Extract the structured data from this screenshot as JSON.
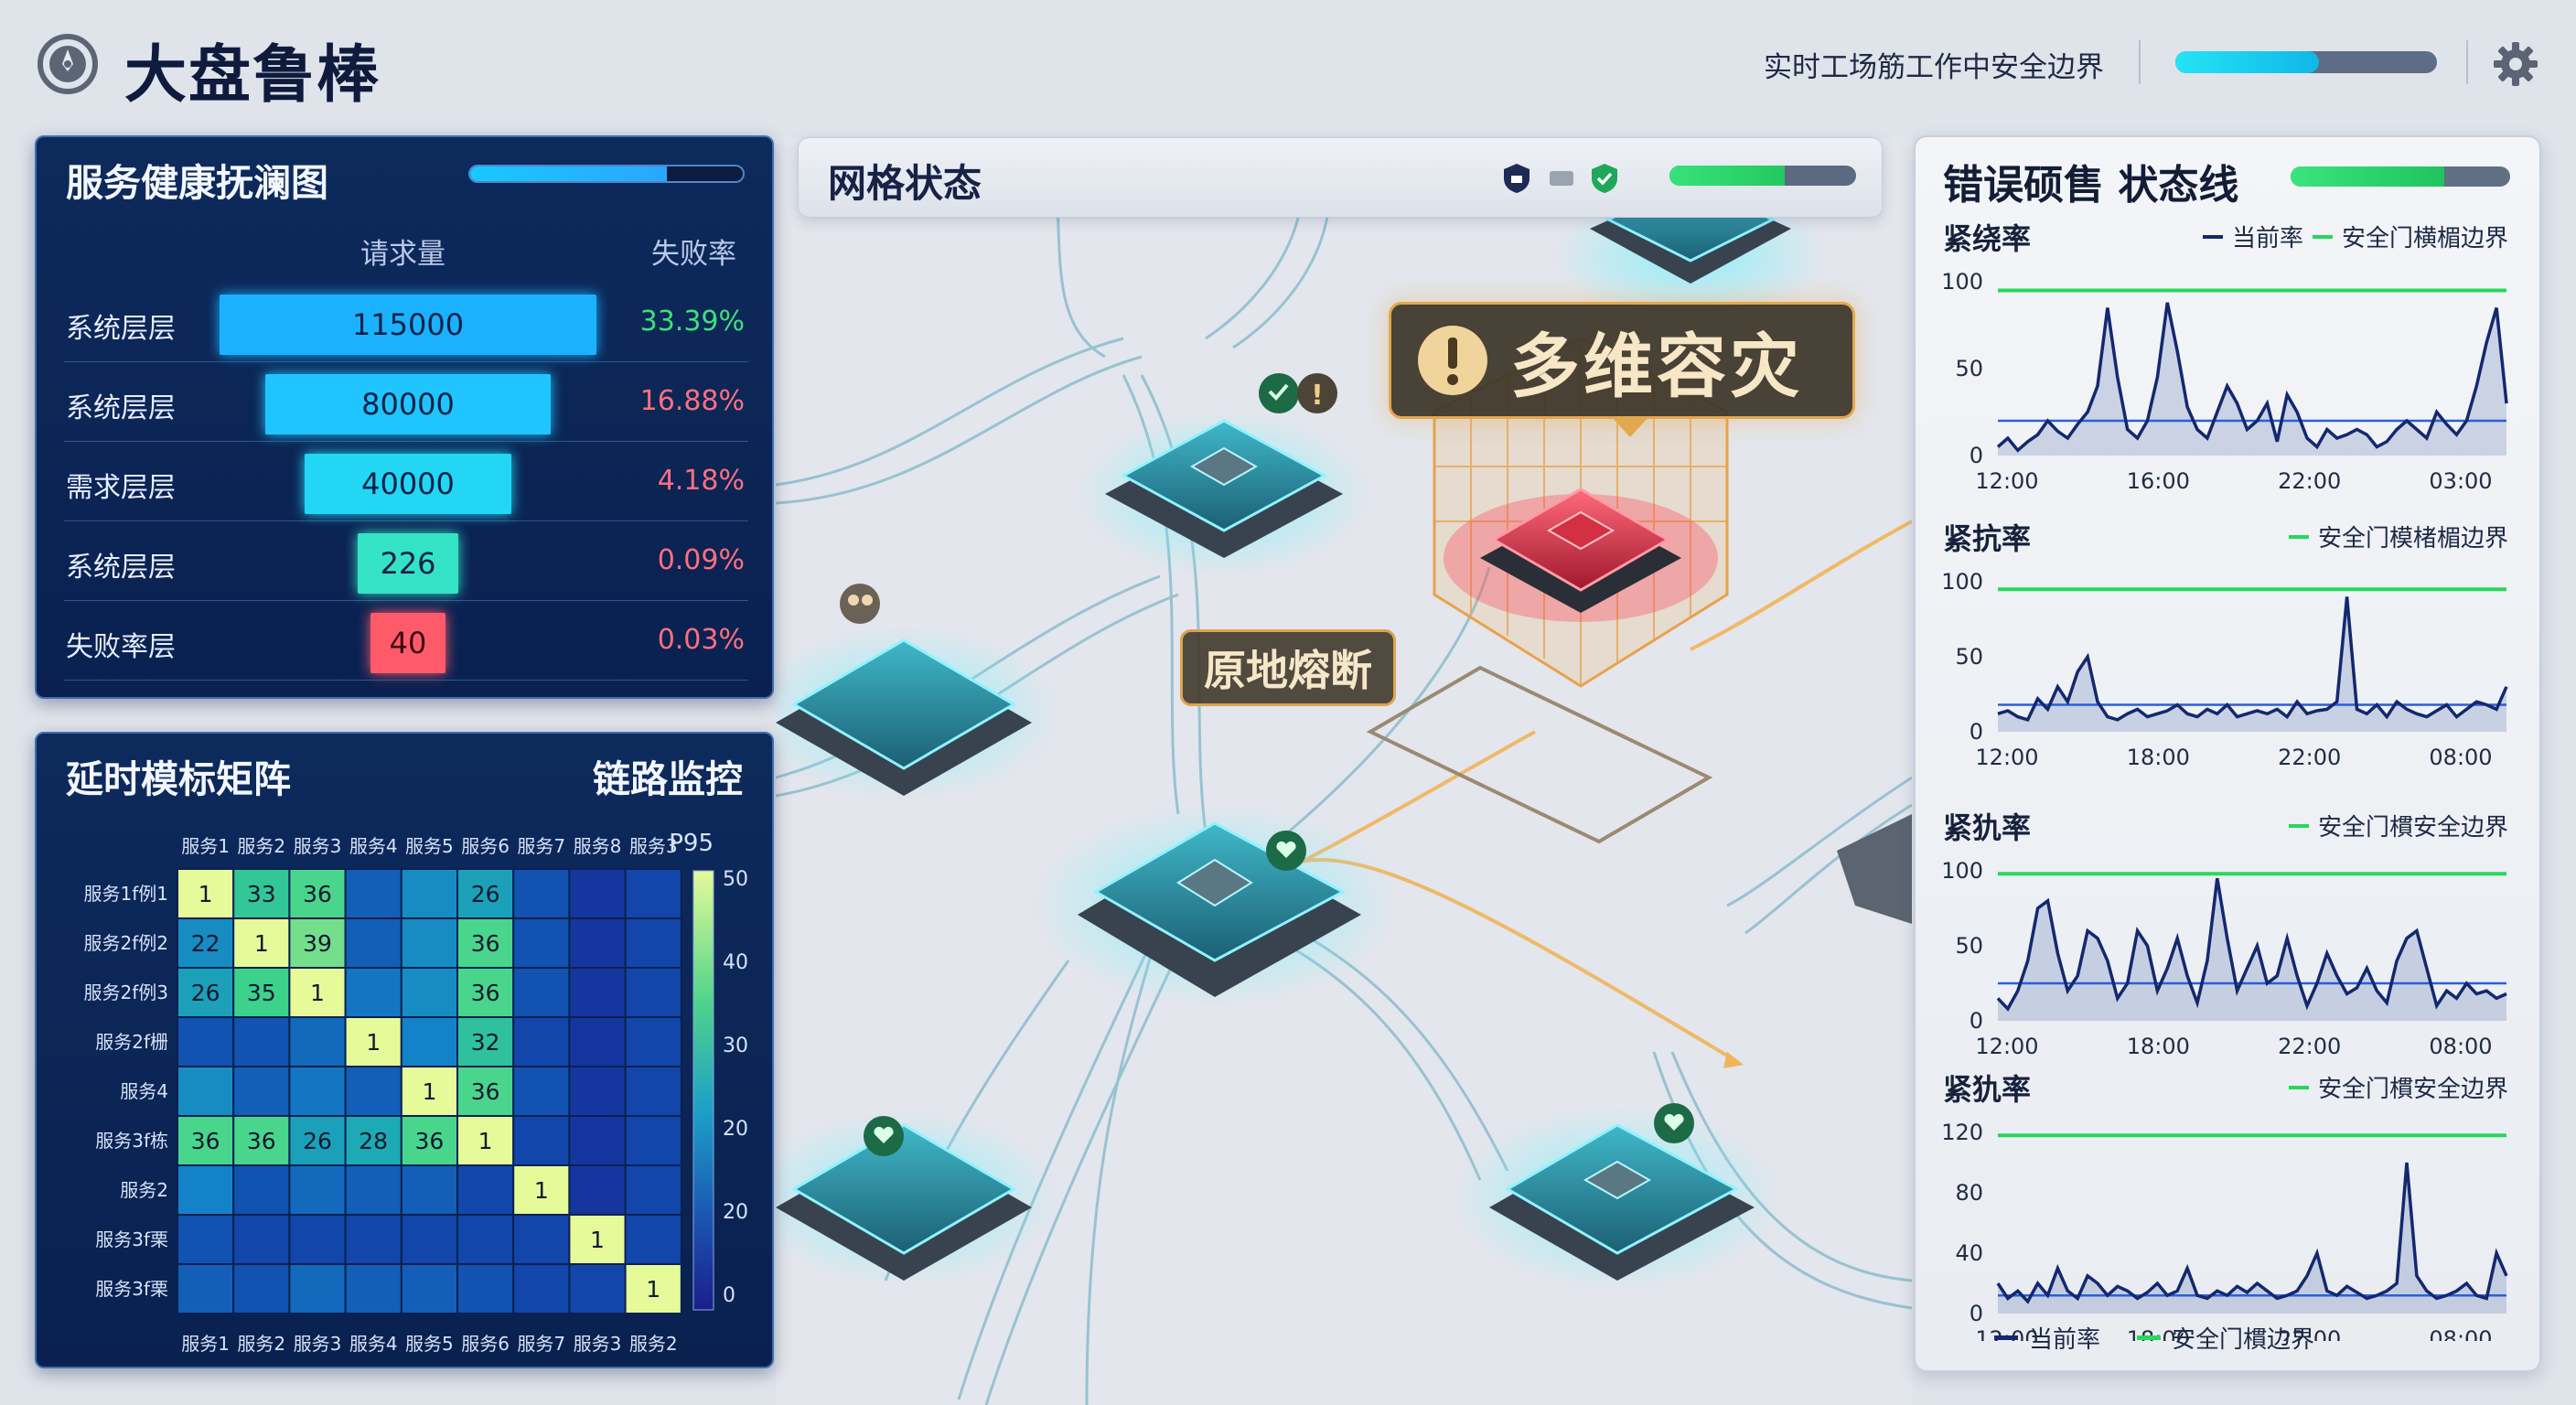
{
  "app": {
    "title": "大盘鲁棒"
  },
  "header": {
    "status_text": "实时工场筋工作中安全边界",
    "progress": 0.55
  },
  "funnel": {
    "title": "服务健康抚澜图",
    "progress": 0.72,
    "col_requests": "请求量",
    "col_fail": "失败率",
    "rows": [
      {
        "label": "系统层层",
        "value": "115000",
        "rate": "33.39%",
        "rate_color": "#3ee07a",
        "bar_color": "#1ab2ff"
      },
      {
        "label": "系统层层",
        "value": "80000",
        "rate": "16.88%",
        "rate_color": "#ff6f7e",
        "bar_color": "#20c4ff"
      },
      {
        "label": "需求层层",
        "value": "40000",
        "rate": "4.18%",
        "rate_color": "#ff6f7e",
        "bar_color": "#22d6f4"
      },
      {
        "label": "系统层层",
        "value": "226",
        "rate": "0.09%",
        "rate_color": "#ff6f7e",
        "bar_color": "#34e3c6"
      },
      {
        "label": "失败率层",
        "value": "40",
        "rate": "0.03%",
        "rate_color": "#ff6f7e",
        "bar_color": "#ff5a6a"
      }
    ]
  },
  "matrix": {
    "title": "延时模标矩阵",
    "subtitle": "链路监控",
    "metric": "P95",
    "col_labels": [
      "服务1",
      "服务2",
      "服务3",
      "服务4",
      "服务5",
      "服务6",
      "服务7",
      "服务8",
      "服务3"
    ],
    "bottom_labels": [
      "服务1",
      "服务2",
      "服务3",
      "服务4",
      "服务5",
      "服务6",
      "服务7",
      "服务3",
      "服务2"
    ],
    "row_labels": [
      "服务1f例1",
      "服务2f例2",
      "服务2f例3",
      "服务2f栅",
      "服务4",
      "服务3f栋",
      "服务2",
      "服务3f栗",
      "服务3f栗"
    ],
    "colorbar_ticks": [
      "50",
      "40",
      "30",
      "20",
      "20",
      "0"
    ],
    "cells": [
      [
        1,
        33,
        36,
        14,
        22,
        26,
        12,
        6,
        10
      ],
      [
        22,
        1,
        39,
        14,
        22,
        36,
        12,
        6,
        10
      ],
      [
        26,
        35,
        1,
        18,
        22,
        36,
        12,
        6,
        10
      ],
      [
        12,
        12,
        16,
        1,
        20,
        32,
        10,
        6,
        10
      ],
      [
        22,
        14,
        18,
        14,
        1,
        36,
        12,
        6,
        10
      ],
      [
        36,
        36,
        26,
        28,
        36,
        1,
        10,
        6,
        10
      ],
      [
        20,
        12,
        16,
        14,
        14,
        10,
        1,
        6,
        10
      ],
      [
        12,
        10,
        10,
        10,
        10,
        10,
        10,
        1,
        10
      ],
      [
        14,
        12,
        16,
        14,
        14,
        12,
        10,
        10,
        1
      ]
    ],
    "labeled": [
      [
        true,
        true,
        true,
        false,
        false,
        true,
        false,
        false,
        false
      ],
      [
        true,
        true,
        true,
        false,
        false,
        true,
        false,
        false,
        false
      ],
      [
        true,
        true,
        true,
        false,
        false,
        true,
        false,
        false,
        false
      ],
      [
        false,
        false,
        false,
        true,
        false,
        true,
        false,
        false,
        false
      ],
      [
        false,
        false,
        false,
        false,
        true,
        true,
        false,
        false,
        false
      ],
      [
        true,
        true,
        true,
        true,
        true,
        true,
        false,
        false,
        false
      ],
      [
        false,
        false,
        false,
        false,
        false,
        false,
        true,
        false,
        false
      ],
      [
        false,
        false,
        false,
        false,
        false,
        false,
        false,
        true,
        false
      ],
      [
        false,
        false,
        false,
        false,
        false,
        false,
        false,
        false,
        true
      ]
    ]
  },
  "mesh": {
    "title": "网格状态",
    "progress": 0.62,
    "alert_text": "多维容灾",
    "local_text": "原地熔断"
  },
  "errors": {
    "title": "错误硕售  状态线",
    "progress": 0.7,
    "charts": [
      {
        "title": "紧绕率",
        "legend_current": "当前率",
        "legend_safe": "安全门横楣边界",
        "yticks": [
          "100",
          "50",
          "0"
        ],
        "ymax": 100,
        "xticks": [
          "12:00",
          "16:00",
          "22:00",
          "03:00"
        ],
        "baseline": 20,
        "threshold": 95,
        "values": [
          5,
          10,
          3,
          8,
          12,
          20,
          14,
          10,
          18,
          25,
          40,
          85,
          45,
          15,
          10,
          20,
          45,
          88,
          60,
          28,
          15,
          10,
          25,
          40,
          30,
          15,
          20,
          30,
          8,
          35,
          25,
          10,
          5,
          15,
          10,
          12,
          15,
          12,
          5,
          8,
          15,
          20,
          15,
          10,
          25,
          18,
          12,
          20,
          40,
          65,
          85,
          30
        ]
      },
      {
        "title": "紧抗率",
        "legend_safe": "安全门模楮楣边界",
        "yticks": [
          "100",
          "50",
          "0"
        ],
        "ymax": 100,
        "xticks": [
          "12:00",
          "18:00",
          "22:00",
          "08:00"
        ],
        "baseline": 18,
        "threshold": 95,
        "values": [
          12,
          14,
          10,
          8,
          22,
          15,
          30,
          20,
          40,
          50,
          20,
          10,
          8,
          12,
          15,
          10,
          12,
          14,
          18,
          12,
          10,
          15,
          12,
          18,
          10,
          12,
          14,
          12,
          15,
          10,
          20,
          12,
          14,
          15,
          20,
          90,
          15,
          12,
          18,
          10,
          20,
          15,
          12,
          10,
          14,
          18,
          10,
          15,
          20,
          18,
          15,
          30
        ]
      },
      {
        "title": "紧犰率",
        "legend_safe": "安全门樌安全边界",
        "yticks": [
          "100",
          "50",
          "0"
        ],
        "ymax": 100,
        "xticks": [
          "12:00",
          "18:00",
          "22:00",
          "08:00"
        ],
        "baseline": 25,
        "threshold": 98,
        "values": [
          15,
          8,
          20,
          40,
          75,
          80,
          45,
          20,
          30,
          60,
          55,
          40,
          15,
          25,
          60,
          50,
          20,
          35,
          55,
          30,
          12,
          40,
          95,
          55,
          20,
          35,
          50,
          25,
          30,
          55,
          30,
          10,
          25,
          45,
          30,
          18,
          22,
          35,
          20,
          12,
          40,
          55,
          60,
          35,
          10,
          20,
          15,
          25,
          18,
          20,
          15,
          18
        ]
      },
      {
        "title": "紧犰率",
        "legend_safe": "安全门樌安全边界",
        "yticks": [
          "120",
          "80",
          "40",
          "0"
        ],
        "ymax": 120,
        "xticks": [
          "12:00",
          "18:00",
          "22:00",
          "08:00"
        ],
        "baseline": 12,
        "threshold": 118,
        "values": [
          20,
          10,
          15,
          8,
          20,
          12,
          30,
          15,
          10,
          25,
          20,
          12,
          18,
          15,
          10,
          14,
          20,
          12,
          15,
          30,
          12,
          10,
          15,
          12,
          18,
          14,
          20,
          15,
          10,
          12,
          15,
          25,
          40,
          15,
          12,
          18,
          14,
          10,
          12,
          15,
          20,
          100,
          25,
          15,
          10,
          12,
          15,
          20,
          12,
          10,
          40,
          25
        ]
      }
    ],
    "bottom_legend_current": "当前率",
    "bottom_legend_safe": "安全门樌边界"
  },
  "colors": {
    "line": "#13286e",
    "safe": "#28d75d",
    "accent": "#1fb8ff",
    "alert": "#e3a84e"
  }
}
